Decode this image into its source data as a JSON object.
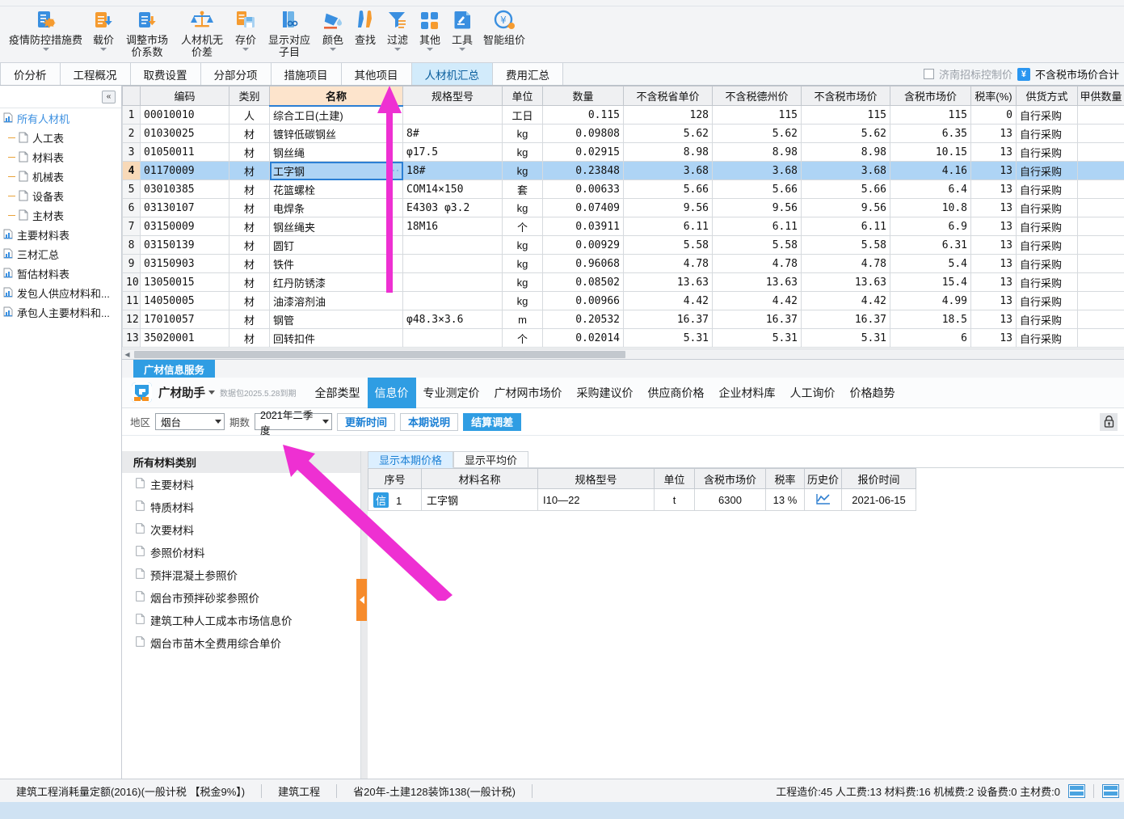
{
  "toolbar": {
    "items": [
      {
        "label": "疫情防控措施费",
        "icon": "epidemic-fee-icon",
        "caret": true,
        "two": false
      },
      {
        "label": "载价",
        "icon": "load-price-icon",
        "caret": true,
        "two": false
      },
      {
        "label": "调整市场价系数",
        "icon": "adjust-market-price-icon",
        "caret": false,
        "two": true
      },
      {
        "label": "人材机无价差",
        "icon": "no-price-diff-icon",
        "caret": false,
        "two": true
      },
      {
        "label": "存价",
        "icon": "save-price-icon",
        "caret": true,
        "two": false
      },
      {
        "label": "显示对应子目",
        "icon": "show-subitem-icon",
        "caret": false,
        "two": true
      },
      {
        "label": "颜色",
        "icon": "color-icon",
        "caret": true,
        "two": false
      },
      {
        "label": "查找",
        "icon": "find-icon",
        "caret": false,
        "two": false
      },
      {
        "label": "过滤",
        "icon": "filter-icon",
        "caret": true,
        "two": false
      },
      {
        "label": "其他",
        "icon": "other-icon",
        "caret": true,
        "two": false
      },
      {
        "label": "工具",
        "icon": "tools-icon",
        "caret": true,
        "two": false
      },
      {
        "label": "智能组价",
        "icon": "smart-pricing-icon",
        "caret": false,
        "two": false
      }
    ]
  },
  "tabs": {
    "items": [
      "价分析",
      "工程概况",
      "取费设置",
      "分部分项",
      "措施项目",
      "其他项目",
      "人材机汇总",
      "费用汇总"
    ],
    "active_index": 6,
    "right": {
      "checkbox_label": "济南招标控制价",
      "badge": "¥",
      "total_label": "不含税市场价合计"
    }
  },
  "sidebar": {
    "collapse_label": "«",
    "items": [
      {
        "label": "所有人材机",
        "icon": "summary-icon",
        "selected": true,
        "child": false
      },
      {
        "label": "人工表",
        "icon": "sheet-icon",
        "selected": false,
        "child": true
      },
      {
        "label": "材料表",
        "icon": "sheet-icon",
        "selected": false,
        "child": true
      },
      {
        "label": "机械表",
        "icon": "sheet-icon",
        "selected": false,
        "child": true
      },
      {
        "label": "设备表",
        "icon": "sheet-icon",
        "selected": false,
        "child": true
      },
      {
        "label": "主材表",
        "icon": "sheet-icon",
        "selected": false,
        "child": true
      },
      {
        "label": "主要材料表",
        "icon": "summary-icon",
        "selected": false,
        "child": false
      },
      {
        "label": "三材汇总",
        "icon": "summary-icon",
        "selected": false,
        "child": false
      },
      {
        "label": "暂估材料表",
        "icon": "summary-icon",
        "selected": false,
        "child": false
      },
      {
        "label": "发包人供应材料和...",
        "icon": "summary-icon",
        "selected": false,
        "child": false
      },
      {
        "label": "承包人主要材料和...",
        "icon": "summary-icon",
        "selected": false,
        "child": false
      }
    ]
  },
  "grid": {
    "columns": [
      "",
      "编码",
      "类别",
      "名称",
      "规格型号",
      "单位",
      "数量",
      "不含税省单价",
      "不含税德州价",
      "不含税市场价",
      "含税市场价",
      "税率(%)",
      "供货方式",
      "甲供数量"
    ],
    "selected_row_index": 3,
    "rows": [
      {
        "idx": "1",
        "code": "00010010",
        "cat": "人",
        "name": "综合工日(土建)",
        "spec": "",
        "unit": "工日",
        "qty": "0.115",
        "p_prov": "128",
        "p_dz": "115",
        "p_mkt": "115",
        "p_tax": "115",
        "rate": "0",
        "supply": "自行采购",
        "jg": ""
      },
      {
        "idx": "2",
        "code": "01030025",
        "cat": "材",
        "name": "镀锌低碳钢丝",
        "spec": "8#",
        "unit": "kg",
        "qty": "0.09808",
        "p_prov": "5.62",
        "p_dz": "5.62",
        "p_mkt": "5.62",
        "p_tax": "6.35",
        "rate": "13",
        "supply": "自行采购",
        "jg": ""
      },
      {
        "idx": "3",
        "code": "01050011",
        "cat": "材",
        "name": "钢丝绳",
        "spec": "φ17.5",
        "unit": "kg",
        "qty": "0.02915",
        "p_prov": "8.98",
        "p_dz": "8.98",
        "p_mkt": "8.98",
        "p_tax": "10.15",
        "rate": "13",
        "supply": "自行采购",
        "jg": ""
      },
      {
        "idx": "4",
        "code": "01170009",
        "cat": "材",
        "name": "工字钢",
        "spec": "18#",
        "unit": "kg",
        "qty": "0.23848",
        "p_prov": "3.68",
        "p_dz": "3.68",
        "p_mkt": "3.68",
        "p_tax": "4.16",
        "rate": "13",
        "supply": "自行采购",
        "jg": ""
      },
      {
        "idx": "5",
        "code": "03010385",
        "cat": "材",
        "name": "花篮螺栓",
        "spec": "COM14×150",
        "unit": "套",
        "qty": "0.00633",
        "p_prov": "5.66",
        "p_dz": "5.66",
        "p_mkt": "5.66",
        "p_tax": "6.4",
        "rate": "13",
        "supply": "自行采购",
        "jg": ""
      },
      {
        "idx": "6",
        "code": "03130107",
        "cat": "材",
        "name": "电焊条",
        "spec": "E4303 φ3.2",
        "unit": "kg",
        "qty": "0.07409",
        "p_prov": "9.56",
        "p_dz": "9.56",
        "p_mkt": "9.56",
        "p_tax": "10.8",
        "rate": "13",
        "supply": "自行采购",
        "jg": ""
      },
      {
        "idx": "7",
        "code": "03150009",
        "cat": "材",
        "name": "钢丝绳夹",
        "spec": "18M16",
        "unit": "个",
        "qty": "0.03911",
        "p_prov": "6.11",
        "p_dz": "6.11",
        "p_mkt": "6.11",
        "p_tax": "6.9",
        "rate": "13",
        "supply": "自行采购",
        "jg": ""
      },
      {
        "idx": "8",
        "code": "03150139",
        "cat": "材",
        "name": "圆钉",
        "spec": "",
        "unit": "kg",
        "qty": "0.00929",
        "p_prov": "5.58",
        "p_dz": "5.58",
        "p_mkt": "5.58",
        "p_tax": "6.31",
        "rate": "13",
        "supply": "自行采购",
        "jg": ""
      },
      {
        "idx": "9",
        "code": "03150903",
        "cat": "材",
        "name": "铁件",
        "spec": "",
        "unit": "kg",
        "qty": "0.96068",
        "p_prov": "4.78",
        "p_dz": "4.78",
        "p_mkt": "4.78",
        "p_tax": "5.4",
        "rate": "13",
        "supply": "自行采购",
        "jg": ""
      },
      {
        "idx": "10",
        "code": "13050015",
        "cat": "材",
        "name": "红丹防锈漆",
        "spec": "",
        "unit": "kg",
        "qty": "0.08502",
        "p_prov": "13.63",
        "p_dz": "13.63",
        "p_mkt": "13.63",
        "p_tax": "15.4",
        "rate": "13",
        "supply": "自行采购",
        "jg": ""
      },
      {
        "idx": "11",
        "code": "14050005",
        "cat": "材",
        "name": "油漆溶剂油",
        "spec": "",
        "unit": "kg",
        "qty": "0.00966",
        "p_prov": "4.42",
        "p_dz": "4.42",
        "p_mkt": "4.42",
        "p_tax": "4.99",
        "rate": "13",
        "supply": "自行采购",
        "jg": ""
      },
      {
        "idx": "12",
        "code": "17010057",
        "cat": "材",
        "name": "钢管",
        "spec": "φ48.3×3.6",
        "unit": "m",
        "qty": "0.20532",
        "p_prov": "16.37",
        "p_dz": "16.37",
        "p_mkt": "16.37",
        "p_tax": "18.5",
        "rate": "13",
        "supply": "自行采购",
        "jg": ""
      },
      {
        "idx": "13",
        "code": "35020001",
        "cat": "材",
        "name": "回转扣件",
        "spec": "",
        "unit": "个",
        "qty": "0.02014",
        "p_prov": "5.31",
        "p_dz": "5.31",
        "p_mkt": "5.31",
        "p_tax": "6",
        "rate": "13",
        "supply": "自行采购",
        "jg": ""
      }
    ]
  },
  "info_panel": {
    "panel_tab": "广材信息服务",
    "assistant_name": "广材助手",
    "expiry": "数据包2025.5.28到期",
    "nav": [
      "全部类型",
      "信息价",
      "专业测定价",
      "广材网市场价",
      "采购建议价",
      "供应商价格",
      "企业材料库",
      "人工询价",
      "价格趋势"
    ],
    "nav_active_index": 1,
    "filter": {
      "region_label": "地区",
      "region_value": "烟台",
      "period_label": "期数",
      "period_value": "2021年二季度",
      "update_time": "更新时间",
      "period_note": "本期说明",
      "settle_adjust": "结算调差",
      "lock_icon": "lock-icon"
    },
    "category": {
      "header": "所有材料类别",
      "items": [
        "主要材料",
        "特质材料",
        "次要材料",
        "参照价材料",
        "预拌混凝土参照价",
        "烟台市预拌砂浆参照价",
        "建筑工种人工成本市场信息价",
        "烟台市苗木全费用综合单价"
      ]
    },
    "result": {
      "tabs": [
        "显示本期价格",
        "显示平均价"
      ],
      "active_tab_index": 0,
      "columns": [
        "序号",
        "材料名称",
        "规格型号",
        "单位",
        "含税市场价",
        "税率",
        "历史价",
        "报价时间"
      ],
      "rows": [
        {
          "badge": "信",
          "idx": "1",
          "name": "工字钢",
          "spec": "I10—22",
          "unit": "t",
          "price": "6300",
          "rate": "13 %",
          "history_icon": "trend-chart-icon",
          "date": "2021-06-15"
        }
      ]
    }
  },
  "statusbar": {
    "left_segments": [
      "建筑工程消耗量定额(2016)(一般计税 【税金9%】)",
      "建筑工程",
      "省20年-土建128装饰138(一般计税)"
    ],
    "right_text": "工程造价:45  人工费:13  材料费:16  机械费:2  设备费:0  主材费:0"
  },
  "colors": {
    "accent_blue": "#2f9de3",
    "selection_blue": "#aed4f5",
    "name_header_orange": "#fde4cc",
    "arrow_magenta": "#ef2fd2",
    "splitter_orange": "#f68b2c"
  }
}
